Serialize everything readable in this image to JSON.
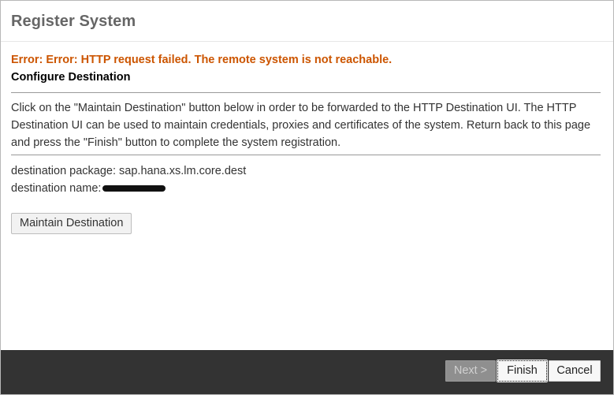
{
  "dialog": {
    "title": "Register System"
  },
  "content": {
    "error": "Error: Error: HTTP request failed. The remote system is not reachable.",
    "section_title": "Configure Destination",
    "description": "Click on the \"Maintain Destination\" button below in order to be forwarded to the HTTP Destination UI. The HTTP Destination UI can be used to maintain credentials, proxies and certificates of the system. Return back to this page and press the \"Finish\" button to complete the system registration.",
    "package_label": "destination package: sap.hana.xs.lm.core.dest",
    "name_label": "destination name:",
    "maintain_button": "Maintain Destination"
  },
  "footer": {
    "next_label": "Next >",
    "finish_label": "Finish",
    "cancel_label": "Cancel"
  }
}
